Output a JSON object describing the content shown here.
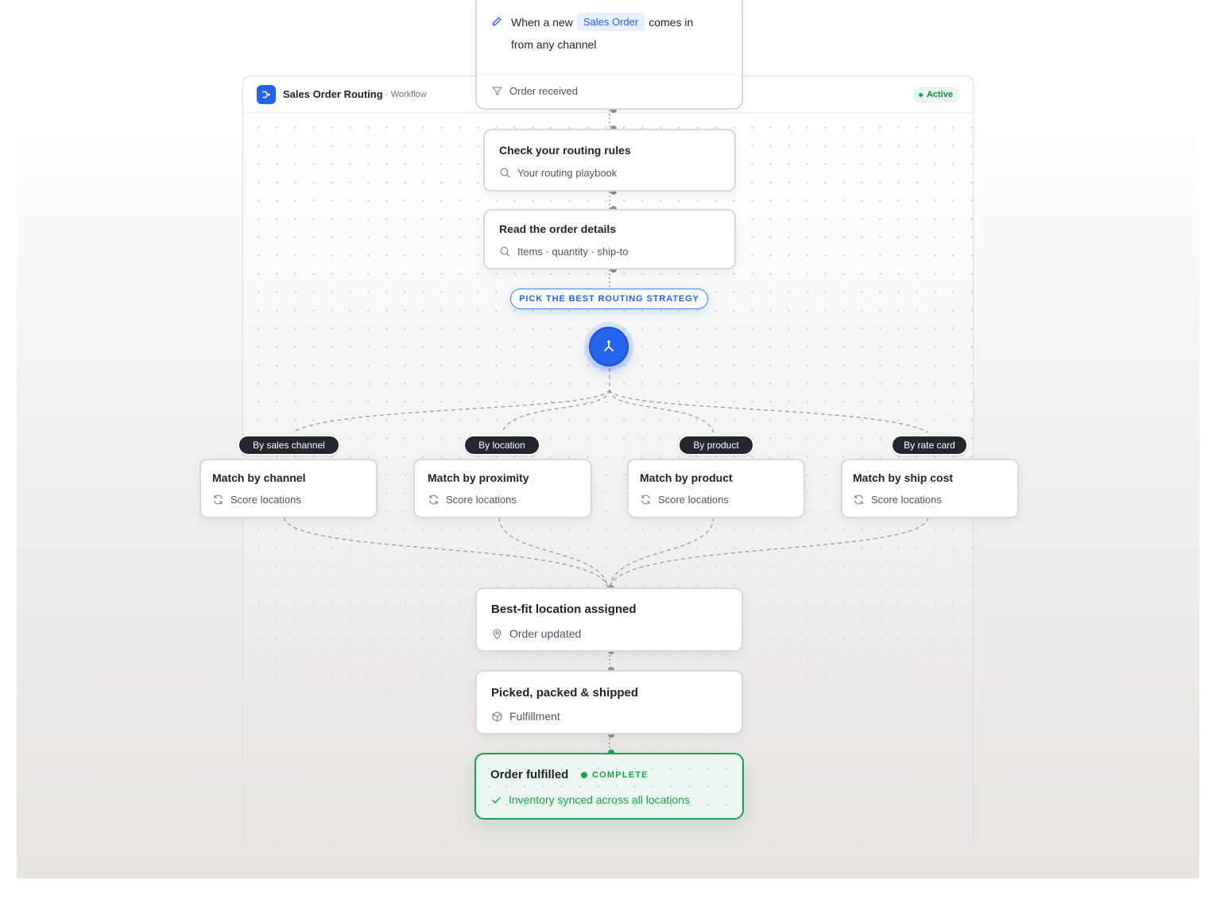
{
  "header": {
    "title": "Sales Order Routing",
    "kind": "· Workflow",
    "status": "Active"
  },
  "trigger": {
    "prefix": "When a new",
    "entity": "Sales Order",
    "suffix": "comes in",
    "line2": "from any channel",
    "event": "Order received"
  },
  "steps": [
    {
      "title": "Check your routing rules",
      "subtitle": "Your routing playbook",
      "icon": "search-icon"
    },
    {
      "title": "Read the order details",
      "subtitle": "Items · quantity · ship-to",
      "icon": "search-icon"
    }
  ],
  "strategy": {
    "label": "PICK THE BEST ROUTING STRATEGY",
    "icon": "split-icon"
  },
  "branches": [
    {
      "tag": "By sales channel",
      "title": "Match by channel",
      "subtitle": "Score locations",
      "icon": "refresh-icon"
    },
    {
      "tag": "By location",
      "title": "Match by proximity",
      "subtitle": "Score locations",
      "icon": "refresh-icon"
    },
    {
      "tag": "By product",
      "title": "Match by product",
      "subtitle": "Score locations",
      "icon": "refresh-icon"
    },
    {
      "tag": "By rate card",
      "title": "Match by ship cost",
      "subtitle": "Score locations",
      "icon": "refresh-icon"
    }
  ],
  "outcomes": [
    {
      "title": "Best-fit location assigned",
      "subtitle": "Order updated",
      "icon": "map-pin-icon"
    },
    {
      "title": "Picked, packed & shipped",
      "subtitle": "Fulfillment",
      "icon": "box-icon"
    }
  ],
  "final": {
    "title": "Order fulfilled",
    "badge": "COMPLETE",
    "subtitle": "Inventory synced across all locations",
    "icon": "check-icon"
  },
  "colors": {
    "accent": "#2563eb",
    "success": "#16a34a",
    "tag_bg": "#22272e"
  }
}
